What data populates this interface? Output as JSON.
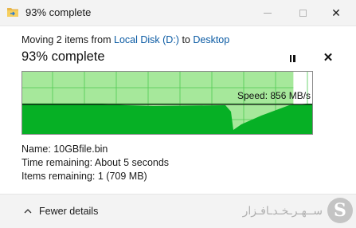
{
  "window": {
    "title": "93% complete",
    "icon": "folder-move-icon",
    "controls": [
      "minimize",
      "maximize",
      "close"
    ]
  },
  "status": {
    "moving_prefix": "Moving 2 items from ",
    "source": "Local Disk (D:)",
    "to_word": " to ",
    "destination": "Desktop",
    "heading": "93% complete",
    "progress_percent": 93
  },
  "graph": {
    "speed_label": "Speed: 856 MB/s",
    "fill_color": "#06b025",
    "remaining_color": "#a6e89b",
    "grid_color": "#4fca52"
  },
  "details": {
    "name": "Name:  10GBfile.bin",
    "time_remaining": "Time remaining:  About 5 seconds",
    "items_remaining": "Items remaining:  1 (709 MB)"
  },
  "footer": {
    "fewer_details": "Fewer details"
  },
  "watermark": {
    "text": "ســهـرـخـدـافـزار",
    "logo_letter": "S"
  }
}
